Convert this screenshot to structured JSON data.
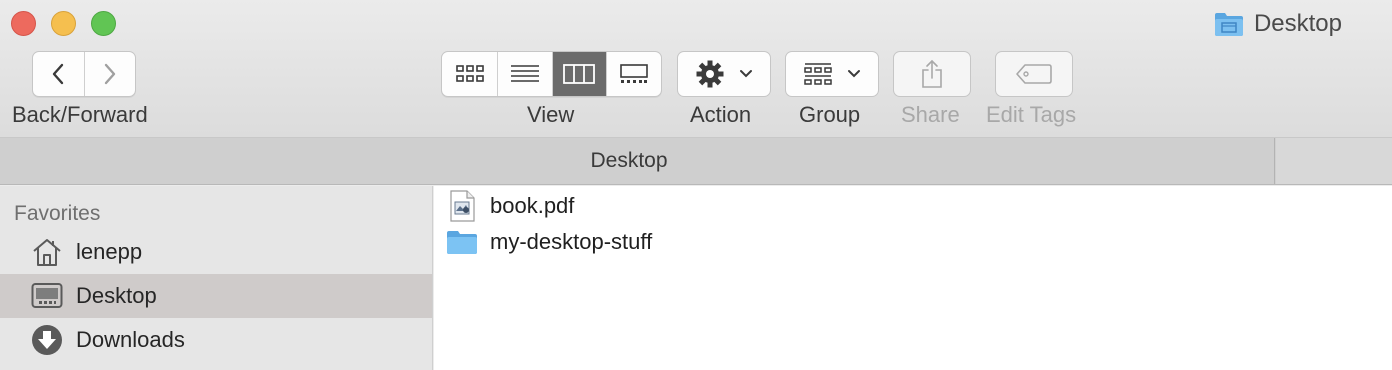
{
  "window": {
    "title": "Desktop"
  },
  "toolbar": {
    "back_forward_label": "Back/Forward",
    "view_label": "View",
    "action_label": "Action",
    "group_label": "Group",
    "share_label": "Share",
    "edit_tags_label": "Edit Tags",
    "view_modes": [
      "icon",
      "list",
      "column",
      "gallery"
    ],
    "active_view_mode": "column"
  },
  "pathbar": {
    "title": "Desktop"
  },
  "sidebar": {
    "section_title": "Favorites",
    "items": [
      {
        "label": "lenepp",
        "icon": "home-icon"
      },
      {
        "label": "Desktop",
        "icon": "desktop-icon",
        "selected": true
      },
      {
        "label": "Downloads",
        "icon": "downloads-icon"
      }
    ]
  },
  "files": [
    {
      "name": "book.pdf",
      "icon": "pdf-file-icon"
    },
    {
      "name": "my-desktop-stuff",
      "icon": "folder-icon"
    }
  ],
  "colors": {
    "selected_sidebar": "#cfcbca",
    "folder_blue": "#6db3e8"
  }
}
